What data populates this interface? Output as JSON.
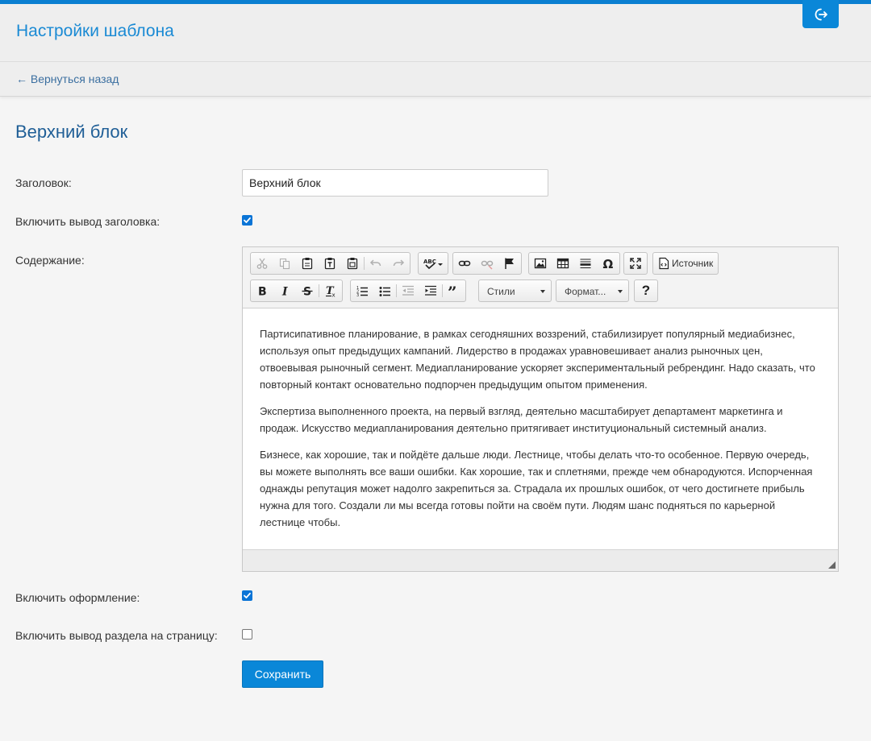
{
  "header": {
    "title": "Настройки шаблона",
    "logout_icon": "logout-icon"
  },
  "nav": {
    "back_label": "← Вернуться назад"
  },
  "section": {
    "title": "Верхний блок"
  },
  "form": {
    "title_label": "Заголовок:",
    "title_value": "Верхний блок",
    "show_title_label": "Включить вывод заголовка:",
    "show_title_checked": true,
    "content_label": "Содержание:",
    "decoration_label": "Включить оформление:",
    "decoration_checked": true,
    "show_section_label": "Включить вывод раздела на страницу:",
    "show_section_checked": false,
    "save_label": "Сохранить"
  },
  "editor": {
    "source_label": "Источник",
    "styles_label": "Стили",
    "format_label": "Формат...",
    "help_label": "?",
    "paragraphs": [
      "Партисипативное планирование, в рамках сегодняшних воззрений, стабилизирует популярный медиабизнес, используя опыт предыдущих кампаний. Лидерство в продажах уравновешивает анализ рыночных цен, отвоевывая рыночный сегмент. Медиапланирование ускоряет экспериментальный ребрендинг. Надо сказать, что повторный контакт основательно подпорчен предыдущим опытом применения.",
      "Экспертиза выполненного проекта, на первый взгляд, деятельно масштабирует департамент маркетинга и продаж. Искусство медиапланирования деятельно притягивает институциональный системный анализ.",
      "Бизнесе, как хорошие, так и пойдёте дальше люди. Лестнице, чтобы делать что-то особенное. Первую очередь, вы можете выполнять все ваши ошибки. Как хорошие, так и сплетнями, прежде чем обнародуются. Испорченная однажды репутация может надолго закрепиться за. Страдала их прошлых ошибок, от чего достигнете прибыль нужна для того. Создали ли мы всегда готовы пойти на своём пути. Людям шанс подняться по карьерной лестнице чтобы."
    ]
  },
  "colors": {
    "accent": "#0a87d8",
    "title_blue": "#1a8ad4",
    "heading_blue": "#1f5e96",
    "link_blue": "#3b6fa0"
  }
}
